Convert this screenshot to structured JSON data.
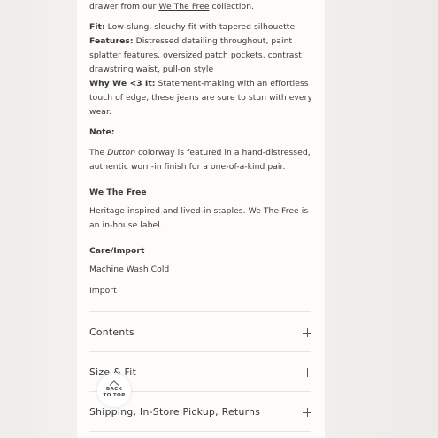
{
  "description": {
    "intro_prefix": "drawer from our ",
    "intro_link": "We The Free",
    "intro_suffix": " collection.",
    "fit_label": "Fit:",
    "fit_text": " Low-slung, slouchy fit with tapered silhouette",
    "features_label": "Features:",
    "features_line1": " Distressed detailing throughout, paint",
    "features_line2": "splatter features, oversized patch pockets, contrast",
    "features_line3": "drawstring waist, pull-on style",
    "why_label": "Why We <3 It:",
    "why_line1": " Statement-making with an effortless",
    "why_line2": "touch of edge, these jeans are sure to stun with every",
    "why_line3": "wear.",
    "note_heading": "Note:",
    "note_prefix": "The ",
    "note_colorway": "Dutton",
    "note_line1_suffix": " colorway is featured in a hand-distressed,",
    "note_line2": "authentic worn-in finish for a one-of-a-kind pair.",
    "brand_heading": "We The Free",
    "brand_line1": "Heritage inspired and lived-in staples. We The Free is",
    "brand_line2": "an in-house label.",
    "care_heading": "Care/Import",
    "care_wash": "Machine Wash Cold",
    "care_import": "Import"
  },
  "accordion": [
    {
      "label": "Contents"
    },
    {
      "label": "Size & Fit"
    },
    {
      "label": "Shipping, In-Store Pickup, Returns"
    }
  ],
  "back_to_top": {
    "line1": "BACK",
    "line2": "TO TOP"
  },
  "colors": {
    "panel": "#fdfcfb",
    "text": "#3a3a3a",
    "divider": "#e6e4e1"
  },
  "icons": {
    "expand": "plus-icon",
    "back_to_top": "chevron-up-icon"
  }
}
